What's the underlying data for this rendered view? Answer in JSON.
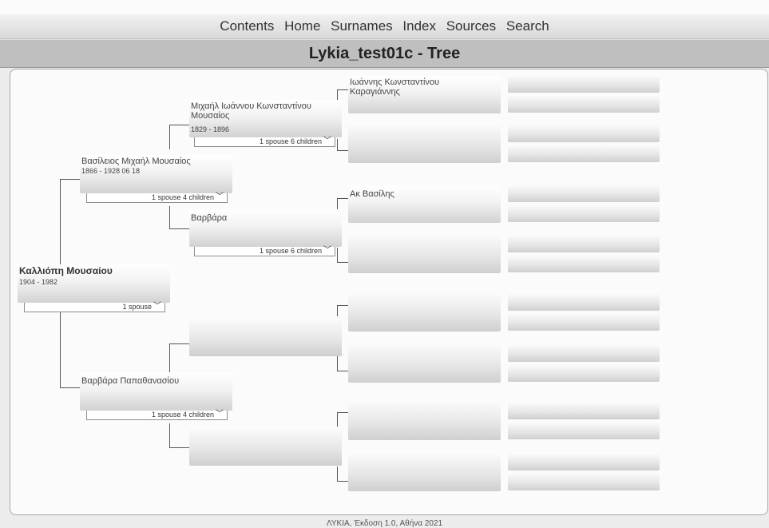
{
  "nav": {
    "items": [
      "Contents",
      "Home",
      "Surnames",
      "Index",
      "Sources",
      "Search"
    ]
  },
  "title": "Lykia_test01c - Tree",
  "tree": {
    "root": {
      "name": "Καλλιόπη Μουσαίου",
      "dates": "1904 - 1982",
      "button": "1 spouse"
    },
    "father": {
      "name": "Βασίλειος Μιχαήλ Μουσαίος",
      "dates": "1866 - 1928 06 18",
      "button": "1 spouse 4 children"
    },
    "mother": {
      "name": "Βαρβάρα Παπαθανασίου",
      "button": "1 spouse 4 children"
    },
    "paternal_grandfather": {
      "name": "Μιχαήλ Ιωάννου Κωνσταντίνου Μουσαίος",
      "dates": "1829 - 1896",
      "button": "1 spouse 6 children"
    },
    "paternal_grandmother": {
      "name": "Βαρβάρα",
      "button": "1 spouse 6 children"
    },
    "ggf1": {
      "name": "Ιωάννης Κωνσταντίνου Καραγιάννης"
    },
    "ggf3": {
      "name": "Ακ Βασίλης"
    }
  },
  "footer": "ΛΥΚΙΑ, Έκδοση 1.0, Αθήνα 2021"
}
